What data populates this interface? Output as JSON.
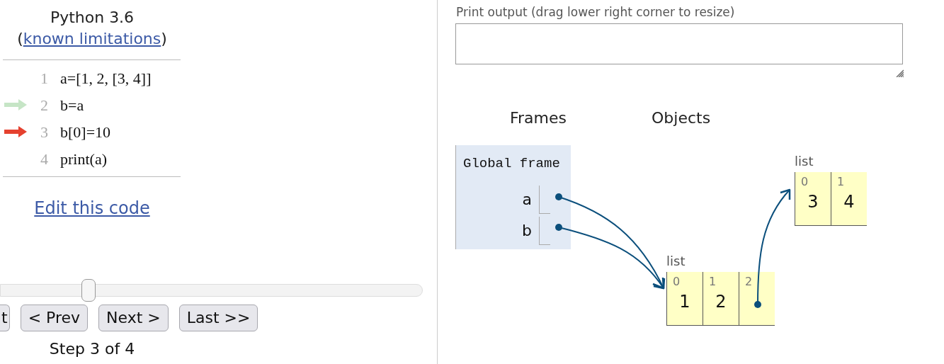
{
  "header": {
    "title": "Python 3.6",
    "link_open": "(",
    "link": "known limitations",
    "link_close": ")"
  },
  "code_lines": [
    {
      "number": "1",
      "code": "a=[1, 2, [3, 4]]",
      "previous": false,
      "current": false
    },
    {
      "number": "2",
      "code": "b=a",
      "previous": true,
      "current": false
    },
    {
      "number": "3",
      "code": "b[0]=10",
      "previous": false,
      "current": true
    },
    {
      "number": "4",
      "code": "print(a)",
      "previous": false,
      "current": false
    }
  ],
  "edit_link": "Edit this code",
  "slider": {
    "level": 0.2
  },
  "buttons": [
    {
      "label": "t",
      "kind": "cut"
    },
    {
      "label": "< Prev",
      "kind": "full"
    },
    {
      "label": "Next >",
      "kind": "full"
    },
    {
      "label": "Last >>",
      "kind": "full"
    }
  ],
  "step": "Step 3 of 4",
  "print_output": {
    "label": "Print output (drag lower right corner to resize)"
  },
  "headings": {
    "frames": "Frames",
    "objects": "Objects"
  },
  "frame": {
    "title": "Global frame",
    "variables": [
      {
        "name": "a"
      },
      {
        "name": "b"
      }
    ]
  },
  "objects": [
    {
      "type_label": "list",
      "items": [
        {
          "index": "0",
          "kind": "value",
          "value": "1"
        },
        {
          "index": "1",
          "kind": "value",
          "value": "2"
        },
        {
          "index": "2",
          "kind": "pointer"
        }
      ]
    },
    {
      "type_label": "list",
      "items": [
        {
          "index": "0",
          "kind": "value",
          "value": "3"
        },
        {
          "index": "1",
          "kind": "value",
          "value": "4"
        }
      ]
    }
  ]
}
